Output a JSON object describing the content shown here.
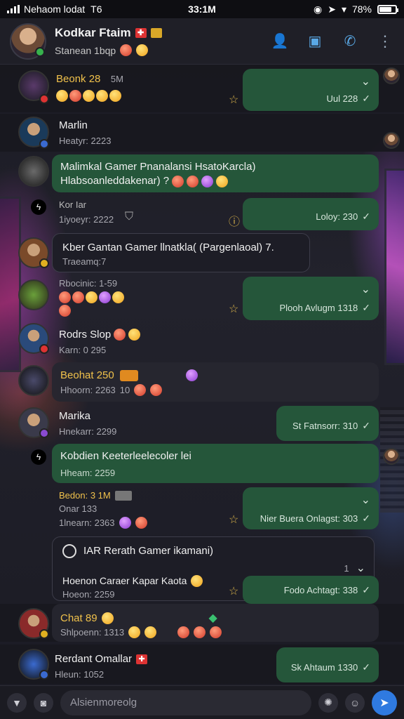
{
  "status_bar": {
    "carrier": "Nehaom lodat",
    "time": "33:1M",
    "battery": "78%",
    "battery_level": 0.78,
    "network_label": "T6"
  },
  "header": {
    "name": "Kodkar Ftaim",
    "status": "Stanean 1bqp"
  },
  "messages": [
    {
      "sender": "Beonk 28",
      "extra": "5M"
    },
    {
      "out_time": "Uul 228"
    },
    {
      "sender": "Marlin",
      "meta": "Heatyr: 2223"
    },
    {
      "text": "Malimkal Gamer Pnanalansi HsatoKarcla)",
      "text2": "Hlabsoanleddakenar) ?"
    },
    {
      "sender": "Kor Iar",
      "meta": "1iyoeyr: 2222"
    },
    {
      "out_time": "Loloy: 230"
    },
    {
      "text": "Kber Gantan Gamer llnatkla( (Pargenlaoal) 7.",
      "meta": "Traeamq:7"
    },
    {
      "sender": "Rbocinic: 1-59"
    },
    {
      "out_time": "Plooh Avlugm 1318"
    },
    {
      "sender": "Rodrs Slop",
      "meta": "Karn: 0 295"
    },
    {
      "sender": "Beohat 250",
      "meta": "Hhoorn: 2263",
      "extra": "10"
    },
    {
      "sender": "Marika",
      "meta": "Hnekarr: 2299"
    },
    {
      "out_time": "St Fatnsorr: 310"
    },
    {
      "sender": "Kobdien Keeterleelecoler lei",
      "meta": "Hheam: 2259"
    },
    {
      "sender": "Bedon: 3 1M",
      "meta": "Onar 133",
      "meta2": "1lnearn: 2363"
    },
    {
      "out_time": "Nier Buera Onlagst: 303"
    },
    {
      "card_title": "IAR Rerath Gamer ikamani)",
      "card_count": "1",
      "sender": "Hoenon Caraer Kapar Kaota",
      "meta": "Hoeon: 2259"
    },
    {
      "out_time": "Fodo Achtagt: 338"
    },
    {
      "sender": "Chat 89",
      "meta": "Shlpoenn: 1313"
    },
    {
      "sender": "Rerdant Omallar",
      "meta": "Hleun: 1052"
    },
    {
      "out_time": "Sk Ahtaum 1330"
    }
  ],
  "input": {
    "placeholder": "Alsienmoreolg"
  }
}
